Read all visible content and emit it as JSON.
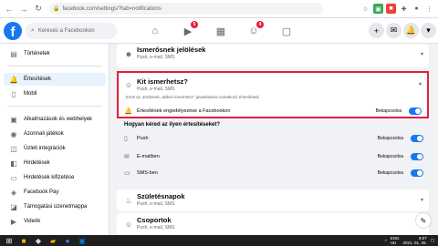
{
  "browser": {
    "url": "facebook.com/settings/?tab=notifications"
  },
  "topbar": {
    "search_placeholder": "Keresés a Facebookon",
    "badges": {
      "watch": "5",
      "groups": "4"
    }
  },
  "sidebar": {
    "items_top": [
      {
        "label": "Történetek",
        "icon": "book-icon"
      }
    ],
    "items_main": [
      {
        "label": "Értesítések",
        "icon": "bell-icon",
        "active": true
      },
      {
        "label": "Mobil",
        "icon": "mobile-icon",
        "active": false
      }
    ],
    "items_bottom": [
      {
        "label": "Alkalmazások és webhelyek",
        "icon": "apps-icon"
      },
      {
        "label": "Azonnali játékok",
        "icon": "gamepad-icon"
      },
      {
        "label": "Üzleti integrációk",
        "icon": "briefcase-icon"
      },
      {
        "label": "Hirdetések",
        "icon": "megaphone-icon"
      },
      {
        "label": "Hirdetések kifizetése",
        "icon": "card-icon"
      },
      {
        "label": "Facebook Pay",
        "icon": "pay-icon"
      },
      {
        "label": "Támogatási üzenetmappa",
        "icon": "inbox-icon"
      },
      {
        "label": "Videók",
        "icon": "video-icon"
      }
    ]
  },
  "cards": {
    "friend_confirm": {
      "title": "Ismerősnek jelölések",
      "sub": "Push, e-mail, SMS"
    },
    "pymk": {
      "title": "Kit ismerhetsz?",
      "sub": "Push, e-mail, SMS",
      "description": "Ezek az „Emberek, akiket ismerhetsz” javaslatokra vonatkozó értesítések.",
      "allow_label": "Értesítések engedélyezése a Facebookon",
      "allow_status": "Bekapcsolva"
    },
    "how_heading": "Hogyan kéred az ilyen értesítéseket?",
    "channels": [
      {
        "label": "Push",
        "status": "Bekapcsolva",
        "icon": "push-icon"
      },
      {
        "label": "E-mailben",
        "status": "Bekapcsolva",
        "icon": "mail-icon"
      },
      {
        "label": "SMS-ben",
        "status": "Bekapcsolva",
        "icon": "sms-icon"
      }
    ],
    "birthdays": {
      "title": "Születésnapok",
      "sub": "Push, e-mail, SMS"
    },
    "groups": {
      "title": "Csoportok",
      "sub": "Push, e-mail, SMS"
    }
  },
  "taskbar": {
    "lang": "ENG\nHU",
    "time": "8:07",
    "date": "2021. 01. 26."
  },
  "colors": {
    "accent": "#1877f2",
    "highlight_border": "#e41e3f"
  }
}
